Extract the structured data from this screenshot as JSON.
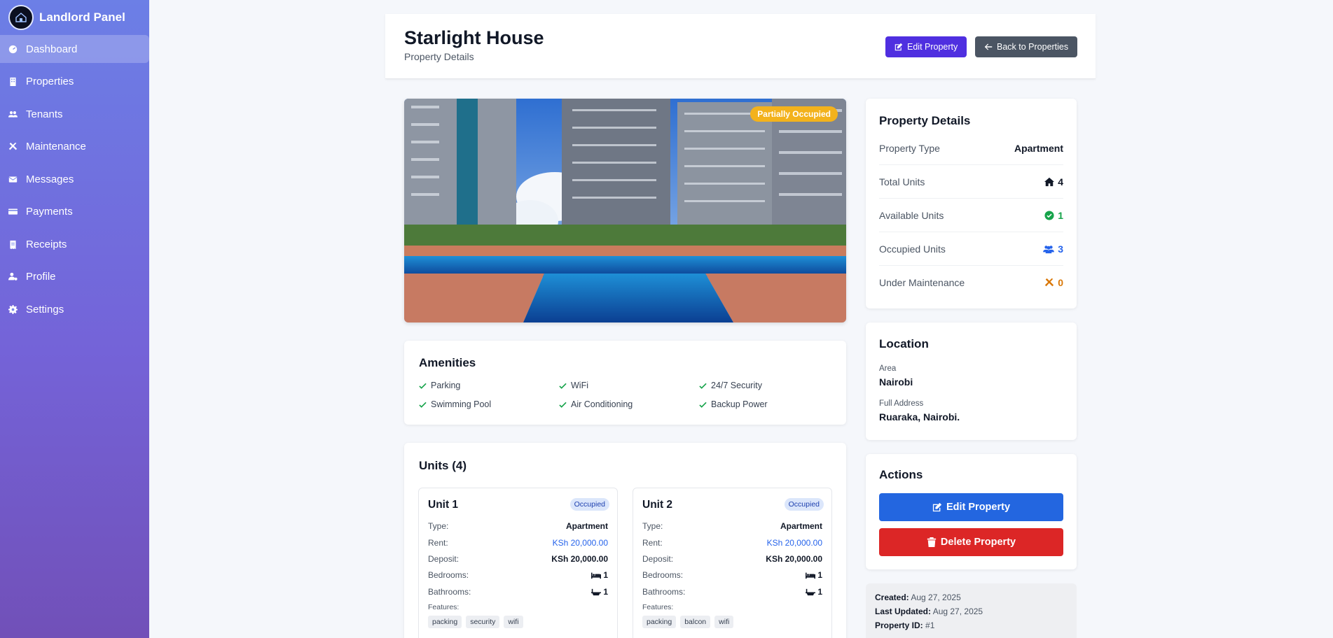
{
  "sidebar": {
    "brand_title": "Landlord Panel",
    "items": [
      {
        "label": "Dashboard",
        "icon": "dashboard-icon",
        "active": true
      },
      {
        "label": "Properties",
        "icon": "building-icon"
      },
      {
        "label": "Tenants",
        "icon": "users-icon"
      },
      {
        "label": "Maintenance",
        "icon": "tools-icon"
      },
      {
        "label": "Messages",
        "icon": "envelope-icon"
      },
      {
        "label": "Payments",
        "icon": "credit-card-icon"
      },
      {
        "label": "Receipts",
        "icon": "receipt-icon"
      },
      {
        "label": "Profile",
        "icon": "user-gear-icon"
      },
      {
        "label": "Settings",
        "icon": "gear-icon"
      }
    ]
  },
  "header": {
    "title": "Starlight House",
    "subtitle": "Property Details",
    "edit_label": "Edit Property",
    "back_label": "Back to Properties"
  },
  "hero": {
    "status": "Partially Occupied",
    "status_color": "#f3b21c"
  },
  "amenities": {
    "title": "Amenities",
    "items": [
      "Parking",
      "WiFi",
      "24/7 Security",
      "Swimming Pool",
      "Air Conditioning",
      "Backup Power"
    ]
  },
  "units": {
    "title": "Units (4)",
    "labels": {
      "type": "Type:",
      "rent": "Rent:",
      "deposit": "Deposit:",
      "bedrooms": "Bedrooms:",
      "bathrooms": "Bathrooms:",
      "features": "Features:"
    },
    "list": [
      {
        "name": "Unit 1",
        "status": "Occupied",
        "type": "Apartment",
        "rent": "KSh 20,000.00",
        "deposit": "KSh 20,000.00",
        "bedrooms": "1",
        "bathrooms": "1",
        "features": [
          "packing",
          "security",
          "wifi"
        ]
      },
      {
        "name": "Unit 2",
        "status": "Occupied",
        "type": "Apartment",
        "rent": "KSh 20,000.00",
        "deposit": "KSh 20,000.00",
        "bedrooms": "1",
        "bathrooms": "1",
        "features": [
          "packing",
          "balcon",
          "wifi"
        ]
      }
    ]
  },
  "details": {
    "title": "Property Details",
    "rows": [
      {
        "label": "Property Type",
        "value": "Apartment",
        "icon": "",
        "color": "#111827"
      },
      {
        "label": "Total Units",
        "value": "4",
        "icon": "home-icon",
        "color": "#111827"
      },
      {
        "label": "Available Units",
        "value": "1",
        "icon": "check-circle-icon",
        "color": "#16a34a"
      },
      {
        "label": "Occupied Units",
        "value": "3",
        "icon": "users-icon",
        "color": "#2563eb"
      },
      {
        "label": "Under Maintenance",
        "value": "0",
        "icon": "tools-icon",
        "color": "#d97706"
      }
    ]
  },
  "location": {
    "title": "Location",
    "area_label": "Area",
    "area": "Nairobi",
    "address_label": "Full Address",
    "address": "Ruaraka, Nairobi."
  },
  "actions": {
    "title": "Actions",
    "edit_label": "Edit Property",
    "delete_label": "Delete Property"
  },
  "meta": {
    "created_label": "Created:",
    "created": "Aug 27, 2025",
    "updated_label": "Last Updated:",
    "updated": "Aug 27, 2025",
    "id_label": "Property ID:",
    "id": "#1"
  }
}
